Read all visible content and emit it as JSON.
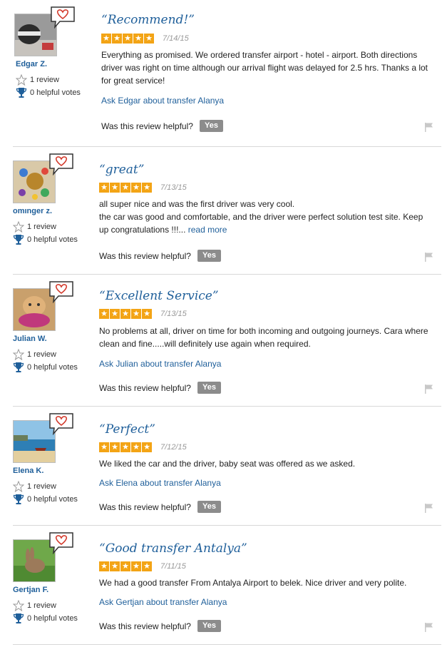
{
  "reviews": [
    {
      "user": "Edgar Z.",
      "reviews_count": "1 review",
      "helpful_votes": "0 helpful votes",
      "title": "“Recommend!”",
      "rating": 5,
      "date": "7/14/15",
      "body": "Everything as promised. We ordered transfer airport - hotel - airport. Both directions driver was right on time although our arrival flight was delayed for 2.5 hrs. Thanks a lot for great service!",
      "read_more": "",
      "ask": "Ask Edgar about transfer Alanya",
      "helpful_question": "Was this review helpful?",
      "yes_label": "Yes"
    },
    {
      "user": "omınger z.",
      "reviews_count": "1 review",
      "helpful_votes": "0 helpful votes",
      "title": "“great”",
      "rating": 5,
      "date": "7/13/15",
      "body": "all super nice and was the first driver was very cool.\nthe car was good and comfortable, and the driver were perfect solution test site. Keep up congratulations !!!...",
      "read_more": "read more",
      "ask": "",
      "helpful_question": "Was this review helpful?",
      "yes_label": "Yes"
    },
    {
      "user": "Julian W.",
      "reviews_count": "1 review",
      "helpful_votes": "0 helpful votes",
      "title": "“Excellent Service”",
      "rating": 5,
      "date": "7/13/15",
      "body": "No problems at all, driver on time for both incoming and outgoing journeys. Cara where clean and fine.....will definitely use again when required.",
      "read_more": "",
      "ask": "Ask Julian about transfer Alanya",
      "helpful_question": "Was this review helpful?",
      "yes_label": "Yes"
    },
    {
      "user": "Elena K.",
      "reviews_count": "1 review",
      "helpful_votes": "0 helpful votes",
      "title": "“Perfect”",
      "rating": 5,
      "date": "7/12/15",
      "body": "We liked the car and the driver, baby seat was offered as we asked.",
      "read_more": "",
      "ask": "Ask Elena about transfer Alanya",
      "helpful_question": "Was this review helpful?",
      "yes_label": "Yes"
    },
    {
      "user": "Gertjan F.",
      "reviews_count": "1 review",
      "helpful_votes": "0 helpful votes",
      "title": "“Good transfer Antalya”",
      "rating": 5,
      "date": "7/11/15",
      "body": "We had a good transfer From Antalya Airport to belek. Nice driver and very polite.",
      "read_more": "",
      "ask": "Ask Gertjan about transfer Alanya",
      "helpful_question": "Was this review helpful?",
      "yes_label": "Yes"
    }
  ],
  "colors": {
    "link": "#1f5f9a",
    "star": "#f3a415",
    "yes_button": "#8c8c8c",
    "heart": "#d33a2c"
  },
  "icons": {
    "heart_bubble": "heart-speech-bubble-icon",
    "review": "star-outline-icon",
    "votes": "trophy-icon",
    "flag": "flag-icon"
  }
}
